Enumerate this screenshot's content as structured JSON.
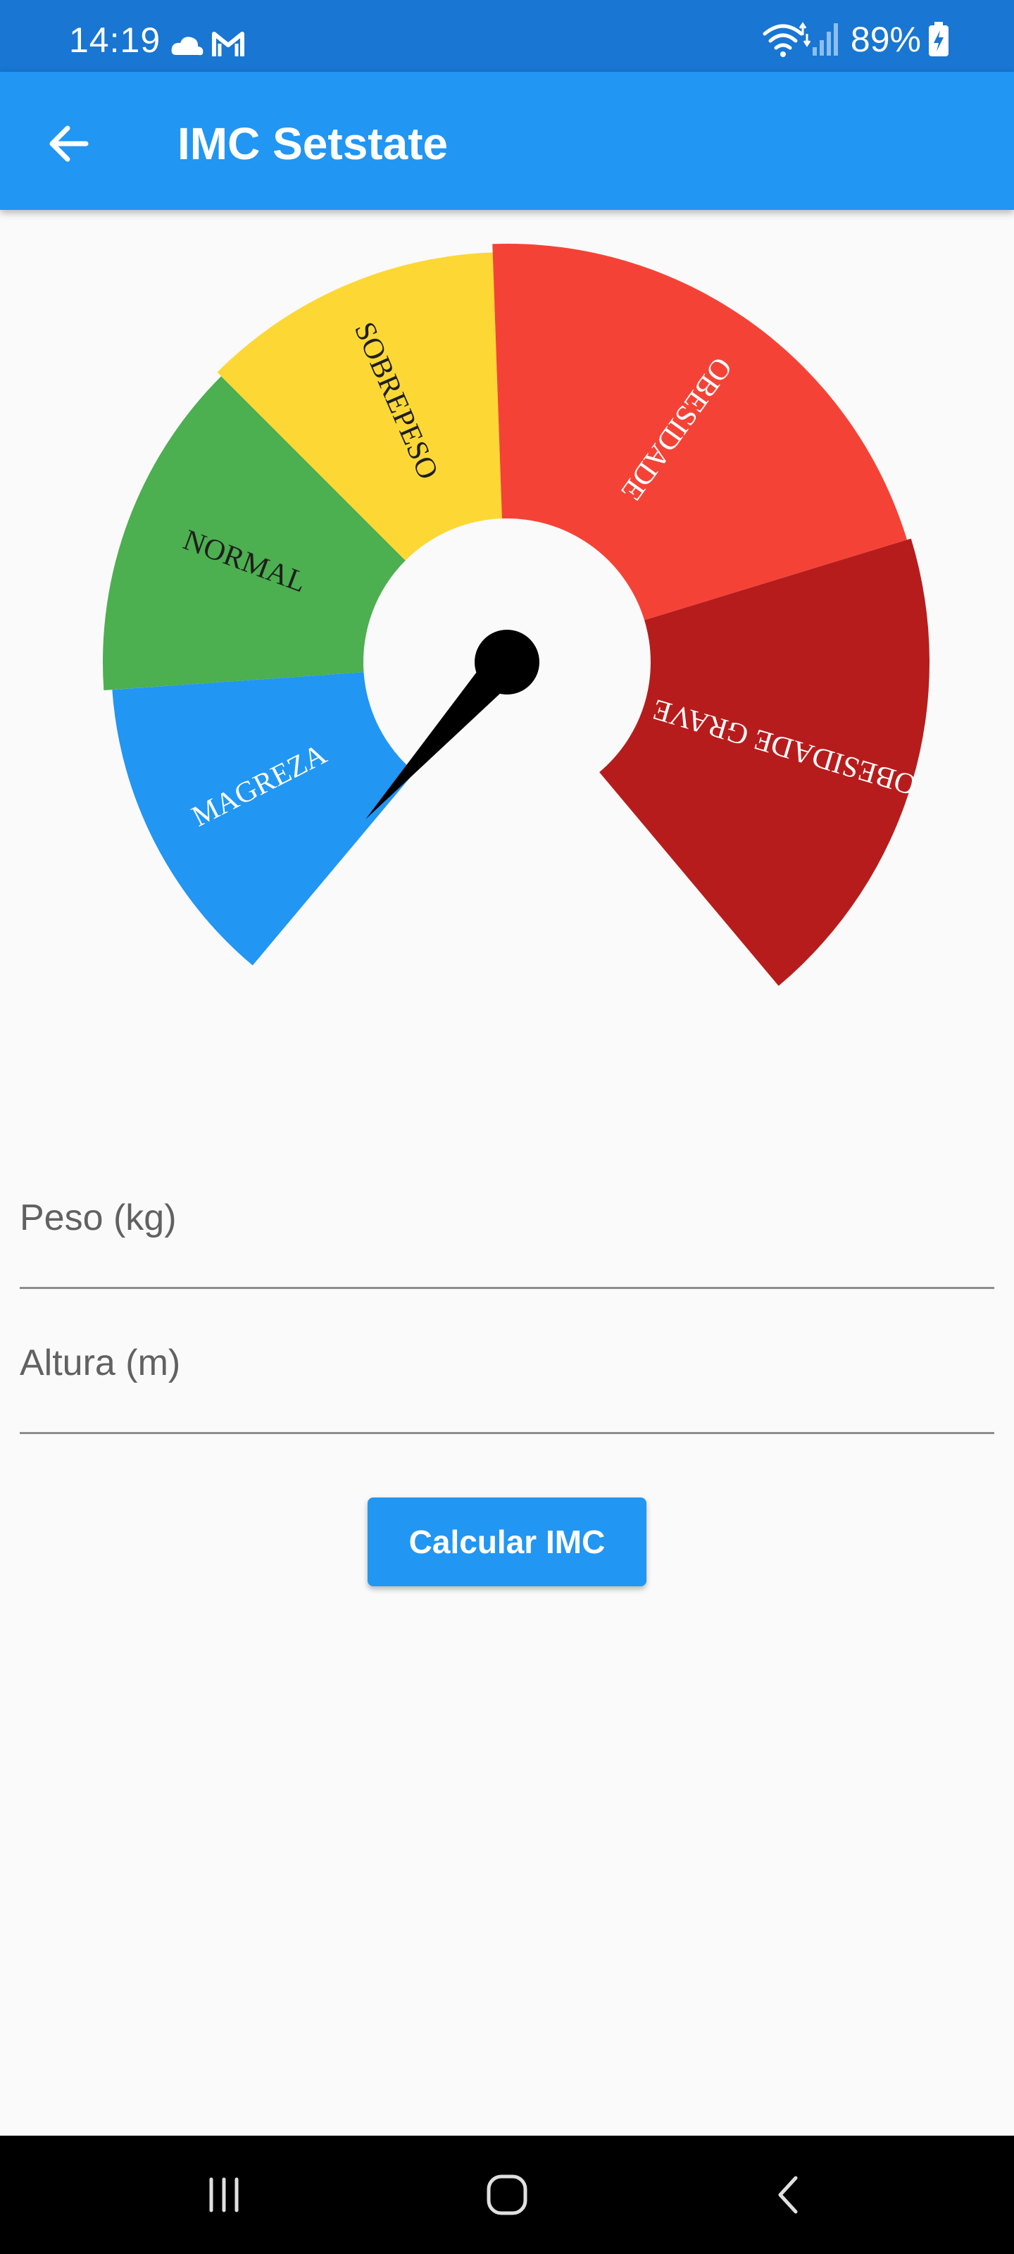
{
  "status_bar": {
    "time": "14:19",
    "left_icons": [
      "cloud-icon",
      "gmail-icon"
    ],
    "right_icons": [
      "wifi-icon",
      "signal-icon",
      "battery-charging-icon"
    ],
    "battery": "89%"
  },
  "app_bar": {
    "back_icon": "arrow-left-icon",
    "title": "IMC Setstate"
  },
  "gauge": {
    "segments": [
      {
        "label": "MAGREZA",
        "color": "#2196f3",
        "text_color": "#ffffff"
      },
      {
        "label": "NORMAL",
        "color": "#4caf50",
        "text_color": "#1e1e1e"
      },
      {
        "label": "SOBREPESO",
        "color": "#fdd835",
        "text_color": "#1e1e1e"
      },
      {
        "label": "OBESIDADE",
        "color": "#f44336",
        "text_color": "#ffffff"
      },
      {
        "label": "OBESIDADE GRAVE",
        "color": "#b71c1c",
        "text_color": "#ffffff"
      }
    ],
    "needle_color": "#000000"
  },
  "form": {
    "peso_label": "Peso (kg)",
    "peso_value": "",
    "altura_label": "Altura (m)",
    "altura_value": "",
    "button_label": "Calcular IMC"
  },
  "nav_bar": {
    "icons": [
      "recents-icon",
      "home-icon",
      "back-icon"
    ]
  }
}
